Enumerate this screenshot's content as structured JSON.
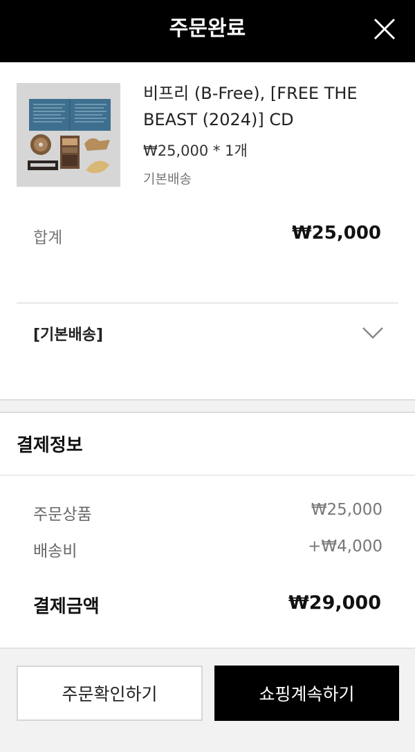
{
  "header": {
    "title": "주문완료",
    "close_icon": "close-icon"
  },
  "product": {
    "name": "비프리 (B-Free), [FREE THE BEAST (2024)] CD",
    "price": "₩25,000 *  1개",
    "shipping_method": "기본배송",
    "thumbnail_icon": "album-cover-image"
  },
  "summary": {
    "total_label": "합계",
    "total_value": "₩25,000"
  },
  "shipping_group": {
    "label": "[기본배송]",
    "toggle_icon": "chevron-down-icon"
  },
  "payment": {
    "title": "결제정보",
    "items_label": "주문상품",
    "items_value": "₩25,000",
    "shipping_label": "배송비",
    "shipping_value": "+₩4,000",
    "total_label": "결제금액",
    "total_value": "₩29,000"
  },
  "buttons": {
    "confirm_order": "주문확인하기",
    "continue_shopping": "쇼핑계속하기"
  },
  "colors": {
    "header_bg": "#000000",
    "primary_button_bg": "#000000",
    "secondary_button_border": "#d6d6d6",
    "page_bg": "#f2f2f2"
  }
}
